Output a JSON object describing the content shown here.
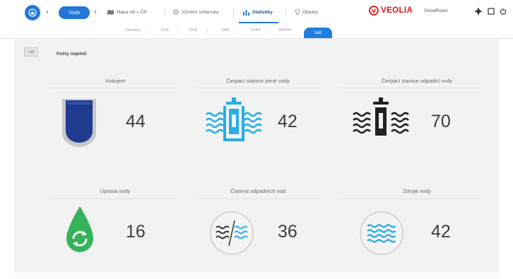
{
  "topbar": {
    "active_pill": "Voda",
    "nav": [
      {
        "label": "Mapa sítí v ČR",
        "icon": "map-icon"
      },
      {
        "label": "Výrobní schémata",
        "icon": "diagram-icon"
      },
      {
        "label": "Statistiky",
        "icon": "bar-chart-icon",
        "active": true
      },
      {
        "label": "Objekty",
        "icon": "location-pin-icon"
      }
    ],
    "brand": "VEOLIA",
    "brand_sub": "ShowRoom",
    "brand_color": "#e3131d",
    "accent": "#2277d9",
    "right_icons": [
      "gear-icon",
      "window-icon",
      "power-icon"
    ]
  },
  "subtabs": {
    "items": [
      "Všechny",
      "SVK",
      "PVK",
      "VHP",
      "SVKS",
      "MOVO"
    ],
    "active": "VaK"
  },
  "panel": {
    "small_button": "×10",
    "section_title": "Počty objektů"
  },
  "cards": [
    {
      "title": "Vodojem",
      "value": "44",
      "icon": "reservoir-icon"
    },
    {
      "title": "Čerpací stanice pitné vody",
      "value": "42",
      "icon": "drinking-water-pump-icon"
    },
    {
      "title": "Čerpací stanice odpadní vody",
      "value": "70",
      "icon": "waste-water-pump-icon"
    },
    {
      "title": "Úprava vody",
      "value": "16",
      "icon": "water-treatment-icon"
    },
    {
      "title": "Čistírna odpadních vod",
      "value": "36",
      "icon": "wastewater-plant-icon"
    },
    {
      "title": "Zdroje vody",
      "value": "42",
      "icon": "water-source-icon"
    }
  ],
  "colors": {
    "reservoir": "#1f3c91",
    "drinking_water": "#27aee3",
    "waste_water": "#222222",
    "treatment": "#34b35a",
    "panel_bg": "#f2f2f2"
  }
}
